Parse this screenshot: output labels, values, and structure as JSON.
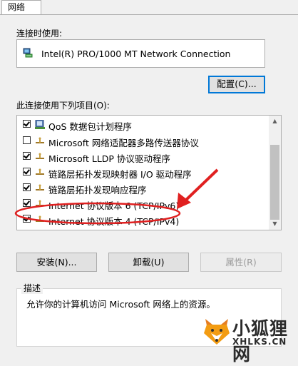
{
  "tab": {
    "label": "网络"
  },
  "connect_using": {
    "label": "连接时使用:",
    "adapter_name": "Intel(R) PRO/1000 MT Network Connection",
    "configure_button": "配置(C)..."
  },
  "items_section": {
    "label": "此连接使用下列项目(O):",
    "items": [
      {
        "label": "QoS 数据包计划程序",
        "checked": true
      },
      {
        "label": "Microsoft 网络适配器多路传送器协议",
        "checked": false
      },
      {
        "label": "Microsoft LLDP 协议驱动程序",
        "checked": true
      },
      {
        "label": "链路层拓扑发现映射器 I/O 驱动程序",
        "checked": true
      },
      {
        "label": "链路层拓扑发现响应程序",
        "checked": true
      },
      {
        "label": "Internet 协议版本 6 (TCP/IPv6)",
        "checked": true
      },
      {
        "label": "Internet 协议版本 4 (TCP/IPv4)",
        "checked": true
      }
    ]
  },
  "buttons": {
    "install": "安装(N)...",
    "uninstall": "卸载(U)",
    "properties": "属性(R)"
  },
  "description": {
    "title": "描述",
    "text": "允许你的计算机访问 Microsoft 网络上的资源。"
  },
  "watermark": {
    "name": "小狐狸网",
    "url": "XHLKS.CN"
  },
  "colors": {
    "accent": "#0078d7",
    "annotation_red": "#e02020",
    "protocol_icon": "#c8a040"
  }
}
